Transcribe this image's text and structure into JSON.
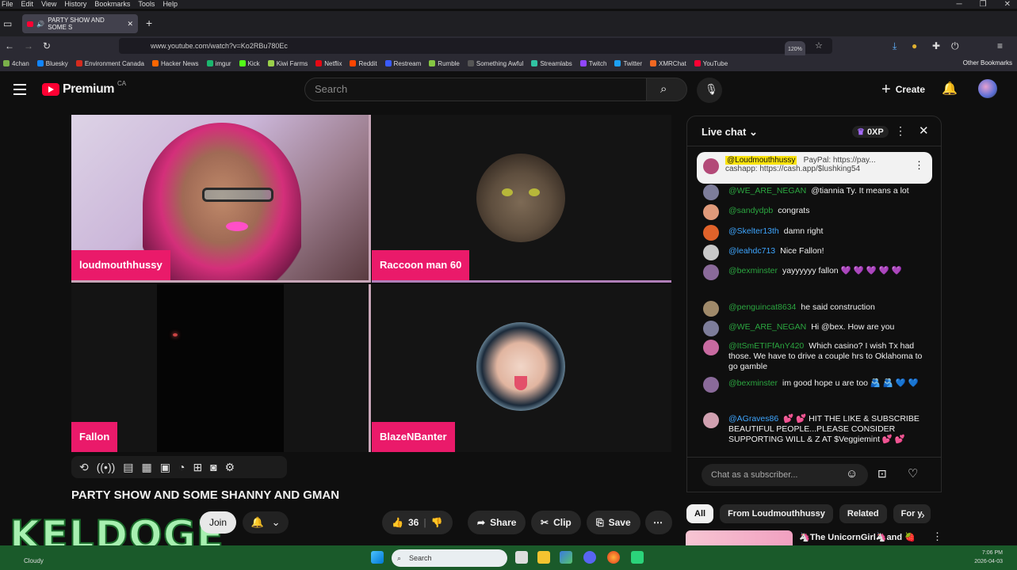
{
  "menubar": [
    "File",
    "Edit",
    "View",
    "History",
    "Bookmarks",
    "Tools",
    "Help"
  ],
  "tab": {
    "title": "PARTY SHOW AND SOME S"
  },
  "url": "www.youtube.com/watch?v=Ko2RBu780Ec",
  "zoom": "120%",
  "bookmarks": [
    {
      "label": "4chan",
      "color": "#7ab04a"
    },
    {
      "label": "Bluesky",
      "color": "#1185fe"
    },
    {
      "label": "Environment Canada",
      "color": "#d52b1e"
    },
    {
      "label": "Hacker News",
      "color": "#ff6600"
    },
    {
      "label": "imgur",
      "color": "#1bb76e"
    },
    {
      "label": "Kick",
      "color": "#53fc18"
    },
    {
      "label": "Kiwi Farms",
      "color": "#9ad04a"
    },
    {
      "label": "Netflix",
      "color": "#e50914"
    },
    {
      "label": "Reddit",
      "color": "#ff4500"
    },
    {
      "label": "Restream",
      "color": "#3a5bff"
    },
    {
      "label": "Rumble",
      "color": "#85c742"
    },
    {
      "label": "Something Awful",
      "color": "#555"
    },
    {
      "label": "Streamlabs",
      "color": "#31c3a2"
    },
    {
      "label": "Twitch",
      "color": "#9146ff"
    },
    {
      "label": "Twitter",
      "color": "#1da1f2"
    },
    {
      "label": "XMRChat",
      "color": "#f26822"
    },
    {
      "label": "YouTube",
      "color": "#ff0033"
    }
  ],
  "other_bookmarks": "Other Bookmarks",
  "youtube": {
    "logo_word": "Premium",
    "region": "CA",
    "search_placeholder": "Search",
    "create_label": "Create"
  },
  "participants": [
    "loudmouthhussy",
    "Raccoon man 60",
    "Fallon",
    "BlazeNBanter"
  ],
  "video_title": "PARTY SHOW AND SOME SHANNY AND GMAN",
  "join_label": "Join",
  "actions": {
    "likes": "36",
    "share": "Share",
    "clip": "Clip",
    "save": "Save"
  },
  "overlay_logo": "KELDOGE",
  "chat": {
    "header": "Live chat",
    "xp": "0XP",
    "pinned": {
      "author": "@Loudmouthhussy",
      "line1": "PayPal: https://pay...",
      "line2": "cashapp: https://cash.app/$lushking54"
    },
    "messages": [
      {
        "author": "@WE_ARE_NEGAN",
        "text": "@tiannia Ty. It means a lot",
        "green": true,
        "avatar": "#7d7d9a"
      },
      {
        "author": "@sandydpb",
        "text": "congrats",
        "green": true,
        "avatar": "#e09a7a"
      },
      {
        "author": "@Skelter13th",
        "text": "damn right",
        "green": false,
        "avatar": "#e0622a"
      },
      {
        "author": "@leahdc713",
        "text": "Nice Fallon!",
        "green": false,
        "avatar": "#c8c8c8"
      },
      {
        "author": "@bexminster",
        "text": "yayyyyyy fallon 💜 💜 💜 💜 💜",
        "green": true,
        "avatar": "#8a6a9a"
      },
      {
        "author": "@penguincat8634",
        "text": "he said construction",
        "green": true,
        "avatar": "#a08a6a"
      },
      {
        "author": "@WE_ARE_NEGAN",
        "text": "Hi @bex. How are you",
        "green": true,
        "avatar": "#7d7d9a"
      },
      {
        "author": "@ItSmETIFfAnY420",
        "text": "Which casino? I wish Tx had those. We have to drive a couple hrs to Oklahoma to go gamble",
        "green": true,
        "avatar": "#c86aa0"
      },
      {
        "author": "@bexminster",
        "text": "im good hope u are too 🫂 🫂 💙 💙",
        "green": true,
        "avatar": "#8a6a9a"
      },
      {
        "author": "@AGraves86",
        "text": "💕 💕 HIT THE LIKE & SUBSCRIBE BEAUTIFUL PEOPLE...PLEASE CONSIDER SUPPORTING WILL & Z AT $Veggiemint 💕 💕",
        "green": false,
        "avatar": "#d0a0b0"
      }
    ],
    "input_placeholder": "Chat as a subscriber..."
  },
  "chips": [
    "All",
    "From Loudmouthhussy",
    "Related",
    "For y"
  ],
  "recommended_title": "🦄The UnicornGirl🦄and 🍓",
  "taskbar": {
    "weather": "Cloudy",
    "search": "Search",
    "time": "7:06 PM",
    "date": "2026-04-03"
  }
}
